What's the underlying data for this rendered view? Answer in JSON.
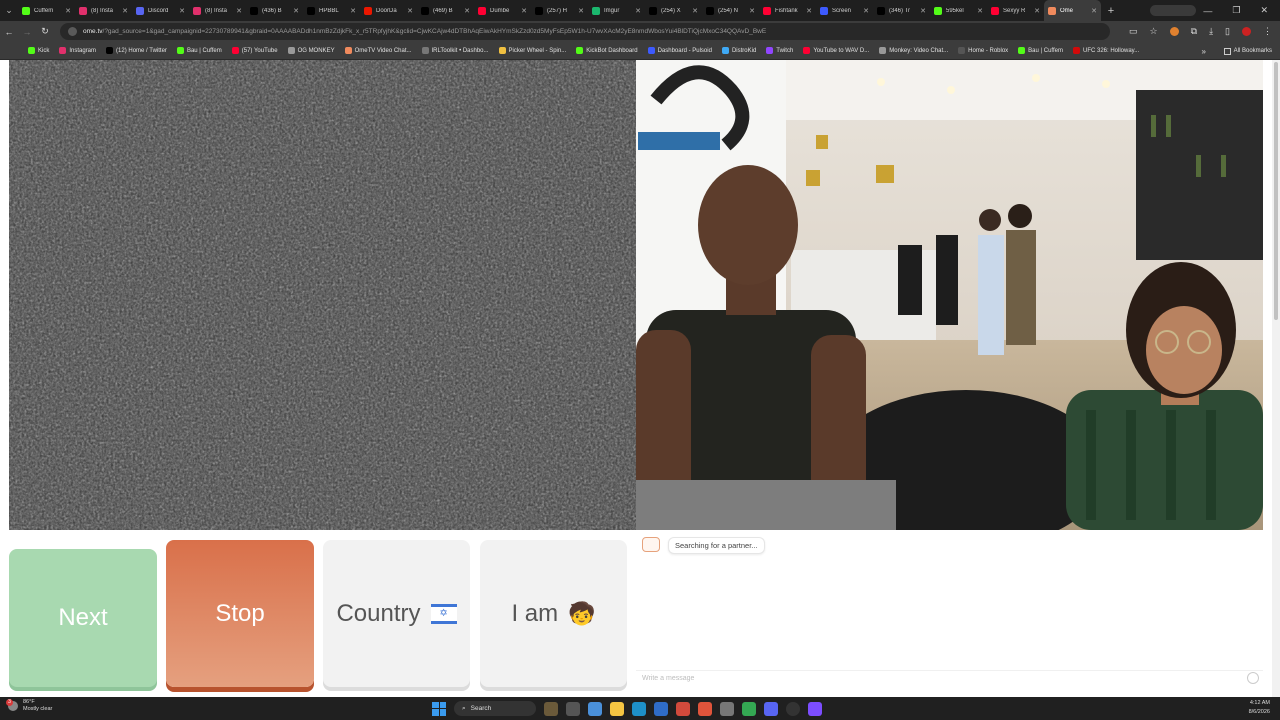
{
  "browser": {
    "tabs": [
      {
        "label": "Cuffem",
        "color": "#53fc18"
      },
      {
        "label": "(8) Insta",
        "color": "#e1306c"
      },
      {
        "label": "Discord",
        "color": "#5865f2"
      },
      {
        "label": "(8) Insta",
        "color": "#e1306c"
      },
      {
        "label": "(436) B",
        "color": "#000000"
      },
      {
        "label": "HPBBL",
        "color": "#000000"
      },
      {
        "label": "DoorDa",
        "color": "#eb1700"
      },
      {
        "label": "(469) B",
        "color": "#000000"
      },
      {
        "label": "Dumbe",
        "color": "#ff0033"
      },
      {
        "label": "(257) H",
        "color": "#000000"
      },
      {
        "label": "Imgur",
        "color": "#1bb76e"
      },
      {
        "label": "(254) X",
        "color": "#000000"
      },
      {
        "label": "(254) N",
        "color": "#000000"
      },
      {
        "label": "Fishtank",
        "color": "#ff0033"
      },
      {
        "label": "Screen",
        "color": "#3d5afe"
      },
      {
        "label": "(346) Tr",
        "color": "#000000"
      },
      {
        "label": "595kel",
        "color": "#53fc18"
      },
      {
        "label": "Sexyy R",
        "color": "#ff0033"
      },
      {
        "label": "Ome",
        "color": "#f08a5d",
        "active": true
      }
    ],
    "url_host": "ome.tv",
    "url_rest": "/?gad_source=1&gad_campaignid=22730789941&gbraid=0AAAABADdh1nmBzZdjkFk_x_r5TRpfyjhK&gclid=CjwKCAjw4dDTBhAqEiwAkHYmSkZzd0zd5MyFsEp5W1h-U7wvXAcM2yE8nmdWbosYui4BlDTiQjcMxoC34QQAvD_BwE",
    "bookmarks": [
      {
        "label": "Kick",
        "color": "#53fc18"
      },
      {
        "label": "Instagram",
        "color": "#e1306c"
      },
      {
        "label": "(12) Home / Twitter",
        "color": "#000000"
      },
      {
        "label": "Bau | Cuffem",
        "color": "#53fc18"
      },
      {
        "label": "(57) YouTube",
        "color": "#ff0033"
      },
      {
        "label": "OG MONKEY",
        "color": "#999999"
      },
      {
        "label": "OmeTV Video Chat...",
        "color": "#f08a5d"
      },
      {
        "label": "IRLToolkit • Dashbo...",
        "color": "#777777"
      },
      {
        "label": "Picker Wheel - Spin...",
        "color": "#f0c040"
      },
      {
        "label": "KickBot Dashboard",
        "color": "#53fc18"
      },
      {
        "label": "Dashboard - Pulsoid",
        "color": "#3d5afe"
      },
      {
        "label": "DistroKid",
        "color": "#3fa9f5"
      },
      {
        "label": "Twitch",
        "color": "#9146ff"
      },
      {
        "label": "YouTube to WAV D...",
        "color": "#ff0033"
      },
      {
        "label": "Monkey: Video Chat...",
        "color": "#999999"
      },
      {
        "label": "Home - Roblox",
        "color": "#555555"
      },
      {
        "label": "Bau | Cuffem",
        "color": "#53fc18"
      },
      {
        "label": "UFC 326: Holloway...",
        "color": "#d20a0a"
      }
    ],
    "all_bookmarks": "All Bookmarks"
  },
  "app": {
    "next_label": "Next",
    "stop_label": "Stop",
    "country_label": "Country",
    "iam_label": "I am",
    "iam_emoji": "🧒",
    "status_message": "Searching for a partner...",
    "input_placeholder": "Write a message",
    "colors": {
      "next": "#a8d9b0",
      "stop": "#df7d55",
      "neutral": "#f2f2f2"
    }
  },
  "taskbar": {
    "weather_temp": "86°F",
    "weather_desc": "Mostly clear",
    "weather_badge": "3",
    "search_label": "Search",
    "time": "4:12 AM",
    "date": "8/6/2026"
  }
}
